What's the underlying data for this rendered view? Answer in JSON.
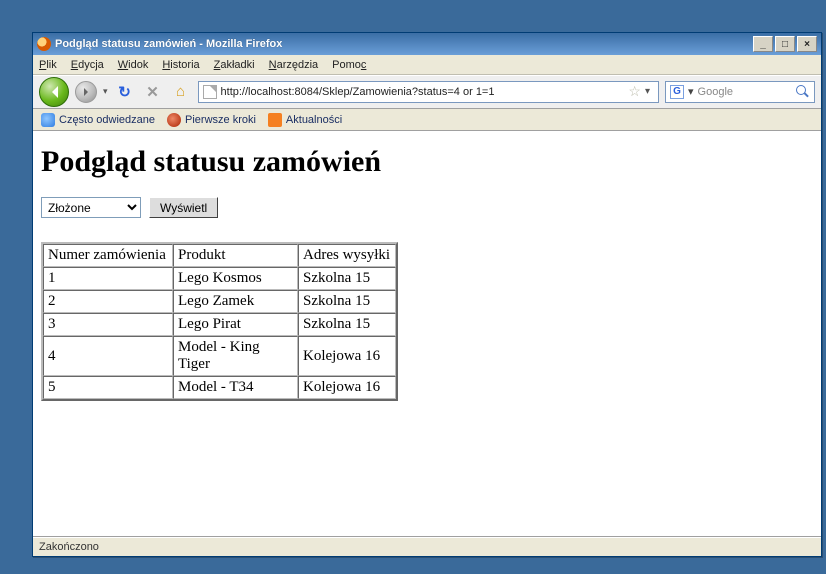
{
  "window": {
    "title": "Podgląd statusu zamówień - Mozilla Firefox",
    "min_label": "_",
    "max_label": "□",
    "close_label": "×"
  },
  "menu": {
    "file": "Plik",
    "edit": "Edycja",
    "view": "Widok",
    "history": "Historia",
    "bookmarks": "Zakładki",
    "tools": "Narzędzia",
    "help": "Pomoc"
  },
  "toolbar": {
    "url": "http://localhost:8084/Sklep/Zamowienia?status=4 or 1=1",
    "search_provider": "G",
    "search_placeholder": "Google"
  },
  "bookmarks": {
    "most_visited": "Często odwiedzane",
    "first_steps": "Pierwsze kroki",
    "news": "Aktualności"
  },
  "page": {
    "heading": "Podgląd statusu zamówień",
    "status_selected": "Złożone",
    "view_button": "Wyświetl",
    "table": {
      "headers": {
        "order_no": "Numer zamówienia",
        "product": "Produkt",
        "address": "Adres wysyłki"
      },
      "rows": [
        {
          "order_no": "1",
          "product": "Lego Kosmos",
          "address": "Szkolna 15"
        },
        {
          "order_no": "2",
          "product": "Lego Zamek",
          "address": "Szkolna 15"
        },
        {
          "order_no": "3",
          "product": "Lego Pirat",
          "address": "Szkolna 15"
        },
        {
          "order_no": "4",
          "product": "Model - King Tiger",
          "address": "Kolejowa 16"
        },
        {
          "order_no": "5",
          "product": "Model - T34",
          "address": "Kolejowa 16"
        }
      ]
    }
  },
  "statusbar": {
    "text": "Zakończono"
  }
}
